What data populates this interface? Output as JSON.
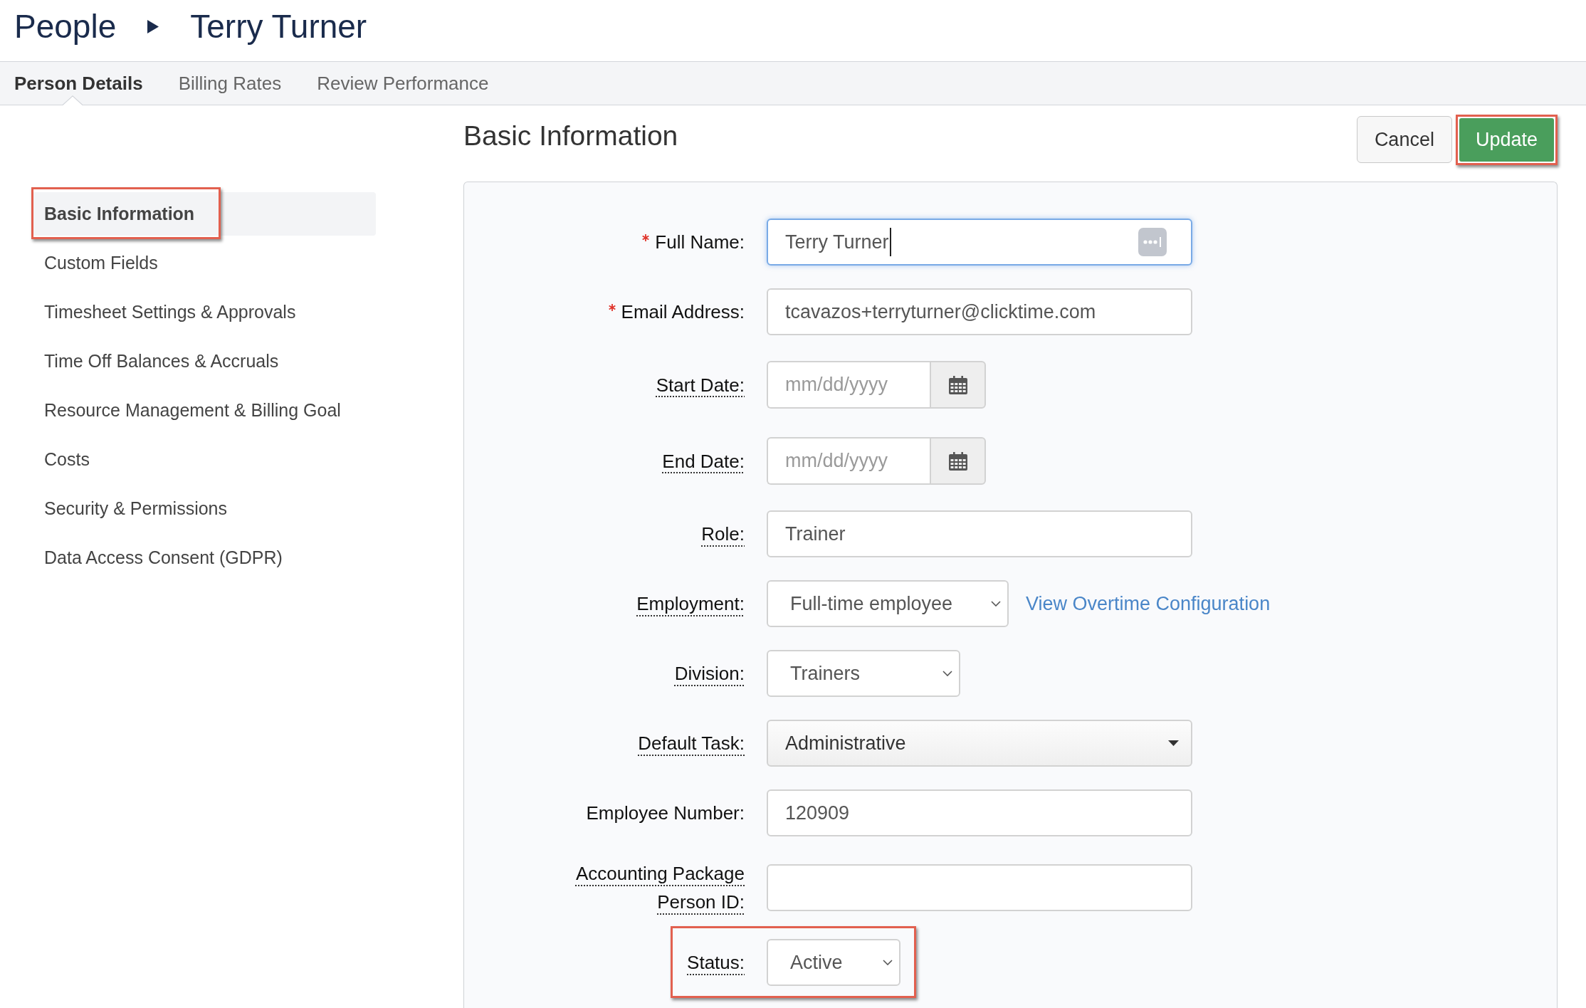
{
  "breadcrumb": {
    "parent": "People",
    "current": "Terry Turner"
  },
  "tabs": [
    {
      "label": "Person Details",
      "selected": true
    },
    {
      "label": "Billing Rates",
      "selected": false
    },
    {
      "label": "Review Performance",
      "selected": false
    }
  ],
  "sidebar": {
    "items": [
      {
        "label": "Basic Information",
        "selected": true,
        "highlighted": true
      },
      {
        "label": "Custom Fields",
        "selected": false,
        "highlighted": false
      },
      {
        "label": "Timesheet Settings & Approvals",
        "selected": false,
        "highlighted": false
      },
      {
        "label": "Time Off Balances & Accruals",
        "selected": false,
        "highlighted": false
      },
      {
        "label": "Resource Management & Billing Goal",
        "selected": false,
        "highlighted": false
      },
      {
        "label": "Costs",
        "selected": false,
        "highlighted": false
      },
      {
        "label": "Security & Permissions",
        "selected": false,
        "highlighted": false
      },
      {
        "label": "Data Access Consent (GDPR)",
        "selected": false,
        "highlighted": false
      }
    ]
  },
  "section": {
    "title": "Basic Information",
    "buttons": [
      {
        "label": "Cancel",
        "kind": "cancel",
        "highlighted": false
      },
      {
        "label": "Update",
        "kind": "submit",
        "highlighted": true
      }
    ]
  },
  "form": {
    "fields": [
      {
        "label": "Full Name:",
        "kind": "text",
        "value": "Terry Turner",
        "required": true,
        "has_tooltip": false,
        "focused": true,
        "highlighted": false
      },
      {
        "label": "Email Address:",
        "kind": "text",
        "value": "tcavazos+terryturner@clicktime.com",
        "required": true,
        "has_tooltip": false,
        "focused": false,
        "highlighted": false
      },
      {
        "label": "Start Date:",
        "kind": "date",
        "placeholder": "mm/dd/yyyy",
        "required": false,
        "has_tooltip": true,
        "focused": false,
        "highlighted": false
      },
      {
        "label": "End Date:",
        "kind": "date",
        "placeholder": "mm/dd/yyyy",
        "required": false,
        "has_tooltip": true,
        "focused": false,
        "highlighted": false
      },
      {
        "label": "Role:",
        "kind": "text",
        "value": "Trainer",
        "required": false,
        "has_tooltip": true,
        "focused": false,
        "highlighted": false
      },
      {
        "label": "Employment:",
        "kind": "select",
        "value": "Full-time employee",
        "link": "View Overtime Configuration",
        "required": false,
        "has_tooltip": true,
        "focused": false,
        "highlighted": false
      },
      {
        "label": "Division:",
        "kind": "select",
        "value": "Trainers",
        "required": false,
        "has_tooltip": true,
        "focused": false,
        "highlighted": false
      },
      {
        "label": "Default Task:",
        "kind": "combo",
        "value": "Administrative",
        "required": false,
        "has_tooltip": true,
        "focused": false,
        "highlighted": false
      },
      {
        "label": "Employee Number:",
        "kind": "text",
        "value": "120909",
        "required": false,
        "has_tooltip": false,
        "focused": false,
        "highlighted": false
      },
      {
        "label": "Accounting Package Person ID:",
        "kind": "text",
        "required": false,
        "has_tooltip": true,
        "focused": false,
        "highlighted": false
      },
      {
        "label": "Status:",
        "kind": "select",
        "value": "Active",
        "required": false,
        "has_tooltip": true,
        "focused": false,
        "highlighted": true
      }
    ]
  }
}
